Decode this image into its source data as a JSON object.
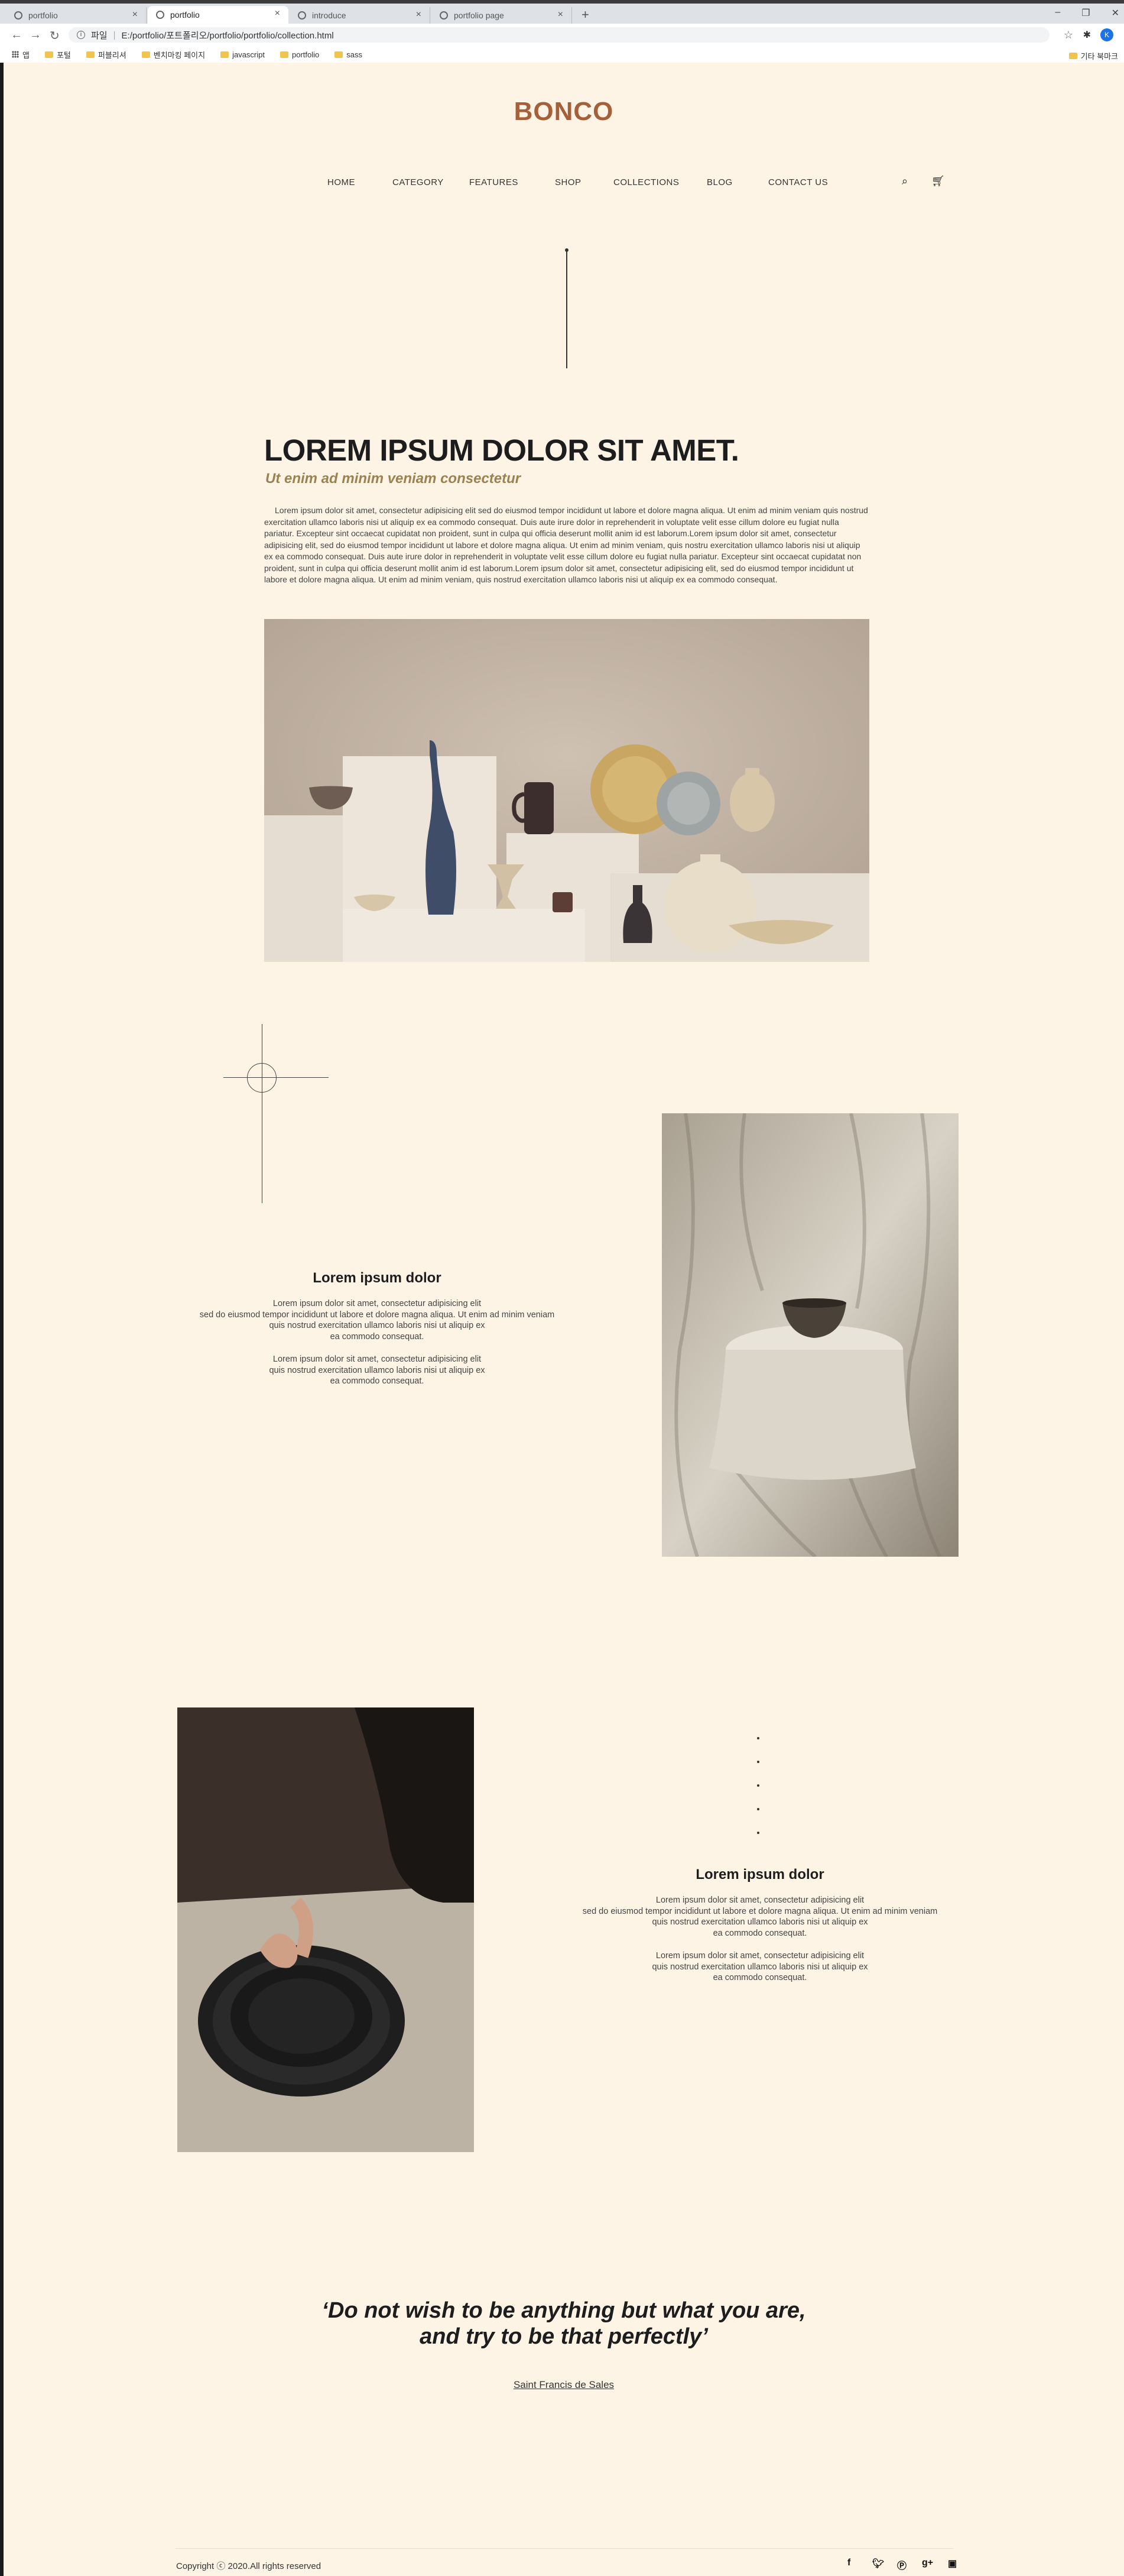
{
  "browser": {
    "tabs": [
      {
        "title": "portfolio",
        "active": false
      },
      {
        "title": "portfolio",
        "active": true
      },
      {
        "title": "introduce",
        "active": false
      },
      {
        "title": "portfolio page",
        "active": false
      }
    ],
    "address": {
      "scheme_label": "파일",
      "url": "E:/portfolio/포트폴리오/portfolio/portfolio/collection.html"
    },
    "profile_initial": "K",
    "bookmarks": [
      {
        "label": "앱",
        "icon": "apps-grid-icon"
      },
      {
        "label": "포털",
        "icon": "folder-icon"
      },
      {
        "label": "퍼블리셔",
        "icon": "folder-icon"
      },
      {
        "label": "벤치마킹 페이지",
        "icon": "folder-icon"
      },
      {
        "label": "javascript",
        "icon": "folder-icon"
      },
      {
        "label": "portfolio",
        "icon": "folder-icon"
      },
      {
        "label": "sass",
        "icon": "folder-icon"
      }
    ],
    "other_bookmarks": "기타 북마크"
  },
  "site": {
    "logo": "BONCO",
    "nav": [
      "HOME",
      "CATEGORY",
      "FEATURES",
      "SHOP",
      "COLLECTIONS",
      "BLOG",
      "CONTACT US"
    ],
    "nav_icons": [
      "search-icon",
      "cart-icon"
    ]
  },
  "hero": {
    "title": "LOREM IPSUM DOLOR SIT AMET.",
    "subtitle": "Ut enim ad minim veniam consectetur",
    "paragraph": "Lorem ipsum dolor sit amet, consectetur adipisicing elit sed do eiusmod tempor incididunt ut labore et dolore magna aliqua. Ut enim ad minim veniam quis nostrud exercitation ullamco laboris nisi ut aliquip ex ea commodo consequat. Duis aute irure dolor in reprehenderit in voluptate velit esse cillum dolore eu fugiat nulla pariatur. Excepteur sint occaecat cupidatat non proident, sunt in culpa qui officia deserunt mollit anim id est laborum.Lorem ipsum dolor sit amet, consectetur adipisicing elit, sed do eiusmod tempor incididunt ut labore et dolore magna aliqua. Ut enim ad minim veniam, quis nostru exercitation ullamco laboris nisi ut aliquip ex ea commodo consequat. Duis aute irure dolor in reprehenderit in voluptate velit esse cillum dolore eu fugiat nulla pariatur. Excepteur sint occaecat cupidatat non proident, sunt in culpa qui officia deserunt mollit anim id est laborum.Lorem ipsum dolor sit amet, consectetur adipisicing elit, sed do eiusmod tempor incididunt ut labore et dolore magna aliqua. Ut enim ad minim veniam, quis nostrud exercitation ullamco laboris nisi ut aliquip ex ea commodo consequat."
  },
  "section1": {
    "title": "Lorem ipsum dolor",
    "para1": [
      "Lorem ipsum dolor sit amet, consectetur adipisicing elit",
      "sed do eiusmod tempor incididunt ut labore et dolore magna aliqua. Ut enim ad minim veniam",
      "quis nostrud exercitation ullamco laboris nisi ut aliquip ex",
      "ea commodo consequat."
    ],
    "para2": [
      "Lorem ipsum dolor sit amet, consectetur adipisicing elit",
      "quis nostrud exercitation ullamco laboris nisi ut aliquip ex",
      "ea commodo consequat."
    ]
  },
  "section2": {
    "title": "Lorem ipsum dolor",
    "para1": [
      "Lorem ipsum dolor sit amet, consectetur adipisicing elit",
      "sed do eiusmod tempor incididunt ut labore et dolore magna aliqua. Ut enim ad minim veniam",
      "quis nostrud exercitation ullamco laboris nisi ut aliquip ex",
      "ea commodo consequat."
    ],
    "para2": [
      "Lorem ipsum dolor sit amet, consectetur adipisicing elit",
      "quis nostrud exercitation ullamco laboris nisi ut aliquip ex",
      "ea commodo consequat."
    ]
  },
  "quote": {
    "line1": "‘Do not wish to be anything but what you are,",
    "line2": "and try to be that perfectly’",
    "author": "Saint Francis de Sales"
  },
  "footer": {
    "copyright": "Copyright ⓒ 2020.All rights reserved",
    "social_icons": [
      "facebook-icon",
      "twitter-icon",
      "pinterest-icon",
      "google-plus-icon",
      "instagram-icon"
    ]
  }
}
